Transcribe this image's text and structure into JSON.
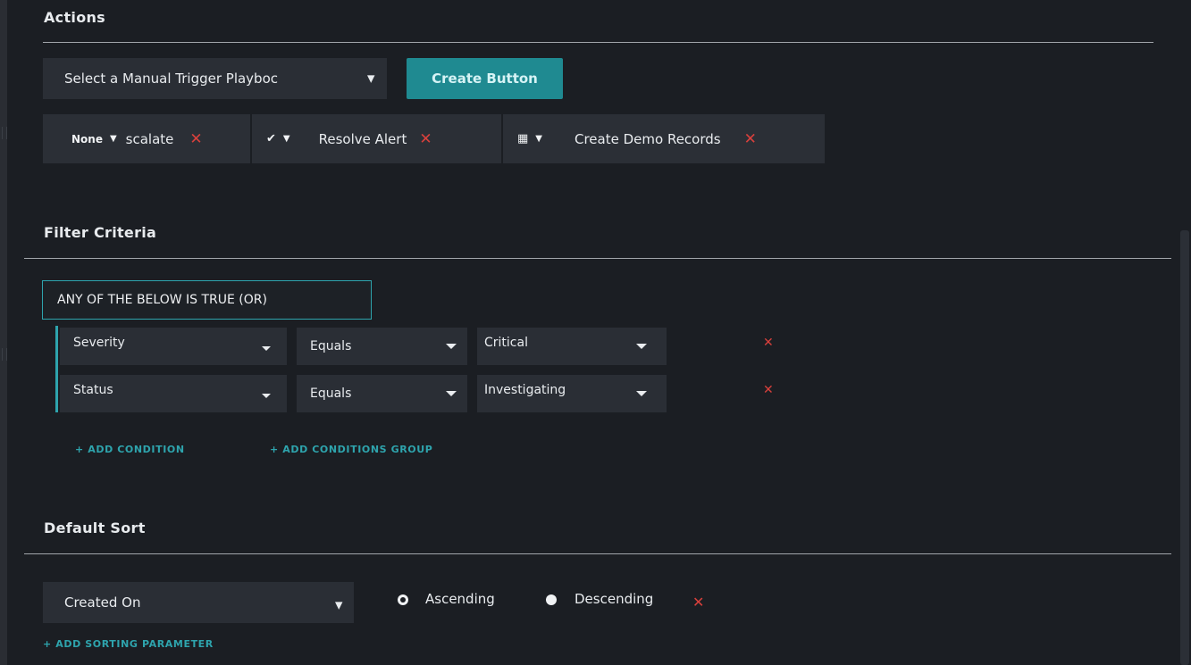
{
  "actions": {
    "title": "Actions",
    "playbook_select": {
      "value": "Select a Manual Trigger Playboc"
    },
    "create_button_label": "Create Button",
    "chips": [
      {
        "icon_text": "None",
        "icon": "none-text",
        "label": "scalate"
      },
      {
        "icon_text": "✔",
        "icon": "check-icon",
        "label": "Resolve Alert"
      },
      {
        "icon_text": "▦",
        "icon": "record-icon",
        "label": "Create Demo Records"
      }
    ],
    "remove_symbol": "✕"
  },
  "filter": {
    "title": "Filter Criteria",
    "logic": "ANY OF THE BELOW IS TRUE (OR)",
    "conditions": [
      {
        "field": "Severity",
        "operator": "Equals",
        "value": "Critical"
      },
      {
        "field": "Status",
        "operator": "Equals",
        "value": "Investigating"
      }
    ],
    "add_condition": "+ ADD CONDITION",
    "add_group": "+ ADD CONDITIONS GROUP"
  },
  "sort": {
    "title": "Default Sort",
    "field": "Created On",
    "options": [
      {
        "label": "Ascending",
        "selected": true
      },
      {
        "label": "Descending",
        "selected": false
      }
    ],
    "add_param": "+ ADD SORTING PARAMETER"
  },
  "colors": {
    "accent": "#2ea4ad",
    "button": "#1f8a91",
    "danger": "#d8403c",
    "background": "#1b1e23",
    "control": "#2a2e35"
  }
}
